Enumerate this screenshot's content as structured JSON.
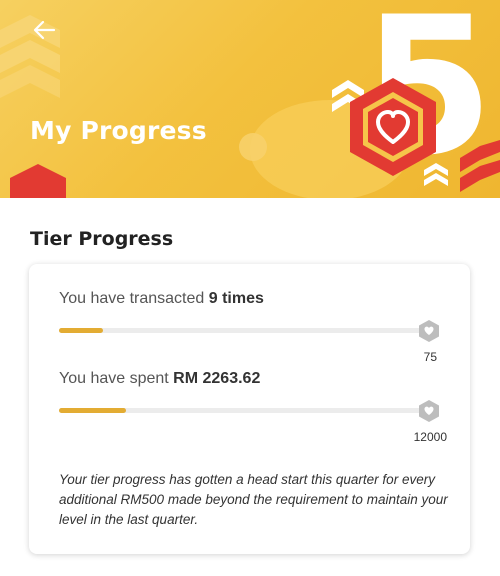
{
  "header": {
    "back_icon": "arrow-left-icon",
    "title": "My Progress",
    "tier_number": "5",
    "badge_icon": "heart-hexagon-icon"
  },
  "section": {
    "title": "Tier Progress"
  },
  "metrics": [
    {
      "prefix": "You have transacted ",
      "value": "9 times",
      "progress_fraction": 0.12,
      "goal_icon": "hexagon-heart-icon",
      "goal_label": "75"
    },
    {
      "prefix": "You have spent ",
      "value": "RM 2263.62",
      "progress_fraction": 0.18,
      "goal_icon": "hexagon-heart-icon",
      "goal_label": "12000"
    }
  ],
  "note": "Your tier progress has gotten a head start this quarter for every additional RM500 made beyond the requirement to maintain your level in the last quarter.",
  "colors": {
    "accent": "#e3ac33",
    "hero": "#f3c13e",
    "badge_red": "#e23a32"
  }
}
